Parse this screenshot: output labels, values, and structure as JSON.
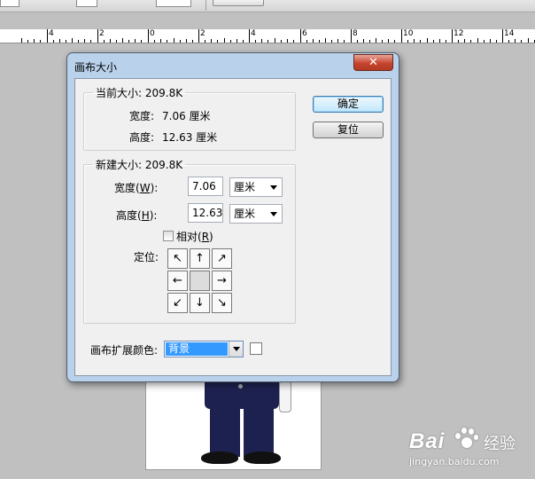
{
  "ruler": {
    "labels": [
      "4",
      "2",
      "0",
      "2",
      "4",
      "6",
      "8",
      "10",
      "12",
      "14"
    ]
  },
  "dialog": {
    "title": "画布大小",
    "close_label": "✕",
    "ok_label": "确定",
    "reset_label": "复位",
    "current": {
      "legend": "当前大小: 209.8K",
      "width_label": "宽度:",
      "width_value": "7.06 厘米",
      "height_label": "高度:",
      "height_value": "12.63 厘米"
    },
    "new": {
      "legend": "新建大小: 209.8K",
      "width_label_prefix": "宽度(",
      "width_label_key": "W",
      "width_label_suffix": "):",
      "width_value": "7.06",
      "width_unit": "厘米",
      "height_label_prefix": "高度(",
      "height_label_key": "H",
      "height_label_suffix": "):",
      "height_value": "12.63",
      "height_unit": "厘米",
      "relative_prefix": "相对(",
      "relative_key": "R",
      "relative_suffix": ")",
      "relative_checked": false,
      "anchor_label": "定位:",
      "anchor_arrows": [
        "↖",
        "↑",
        "↗",
        "←",
        "",
        "→",
        "↙",
        "↓",
        "↘"
      ]
    },
    "extension_color": {
      "label": "画布扩展颜色:",
      "value": "背景"
    }
  },
  "watermark": {
    "brand": "Bai",
    "brand2": "经验",
    "url": "jingyan.baidu.com"
  },
  "colors": {
    "dialog_frame": "#b9d1ea",
    "close_button": "#c7442f",
    "selection": "#3399ff"
  }
}
